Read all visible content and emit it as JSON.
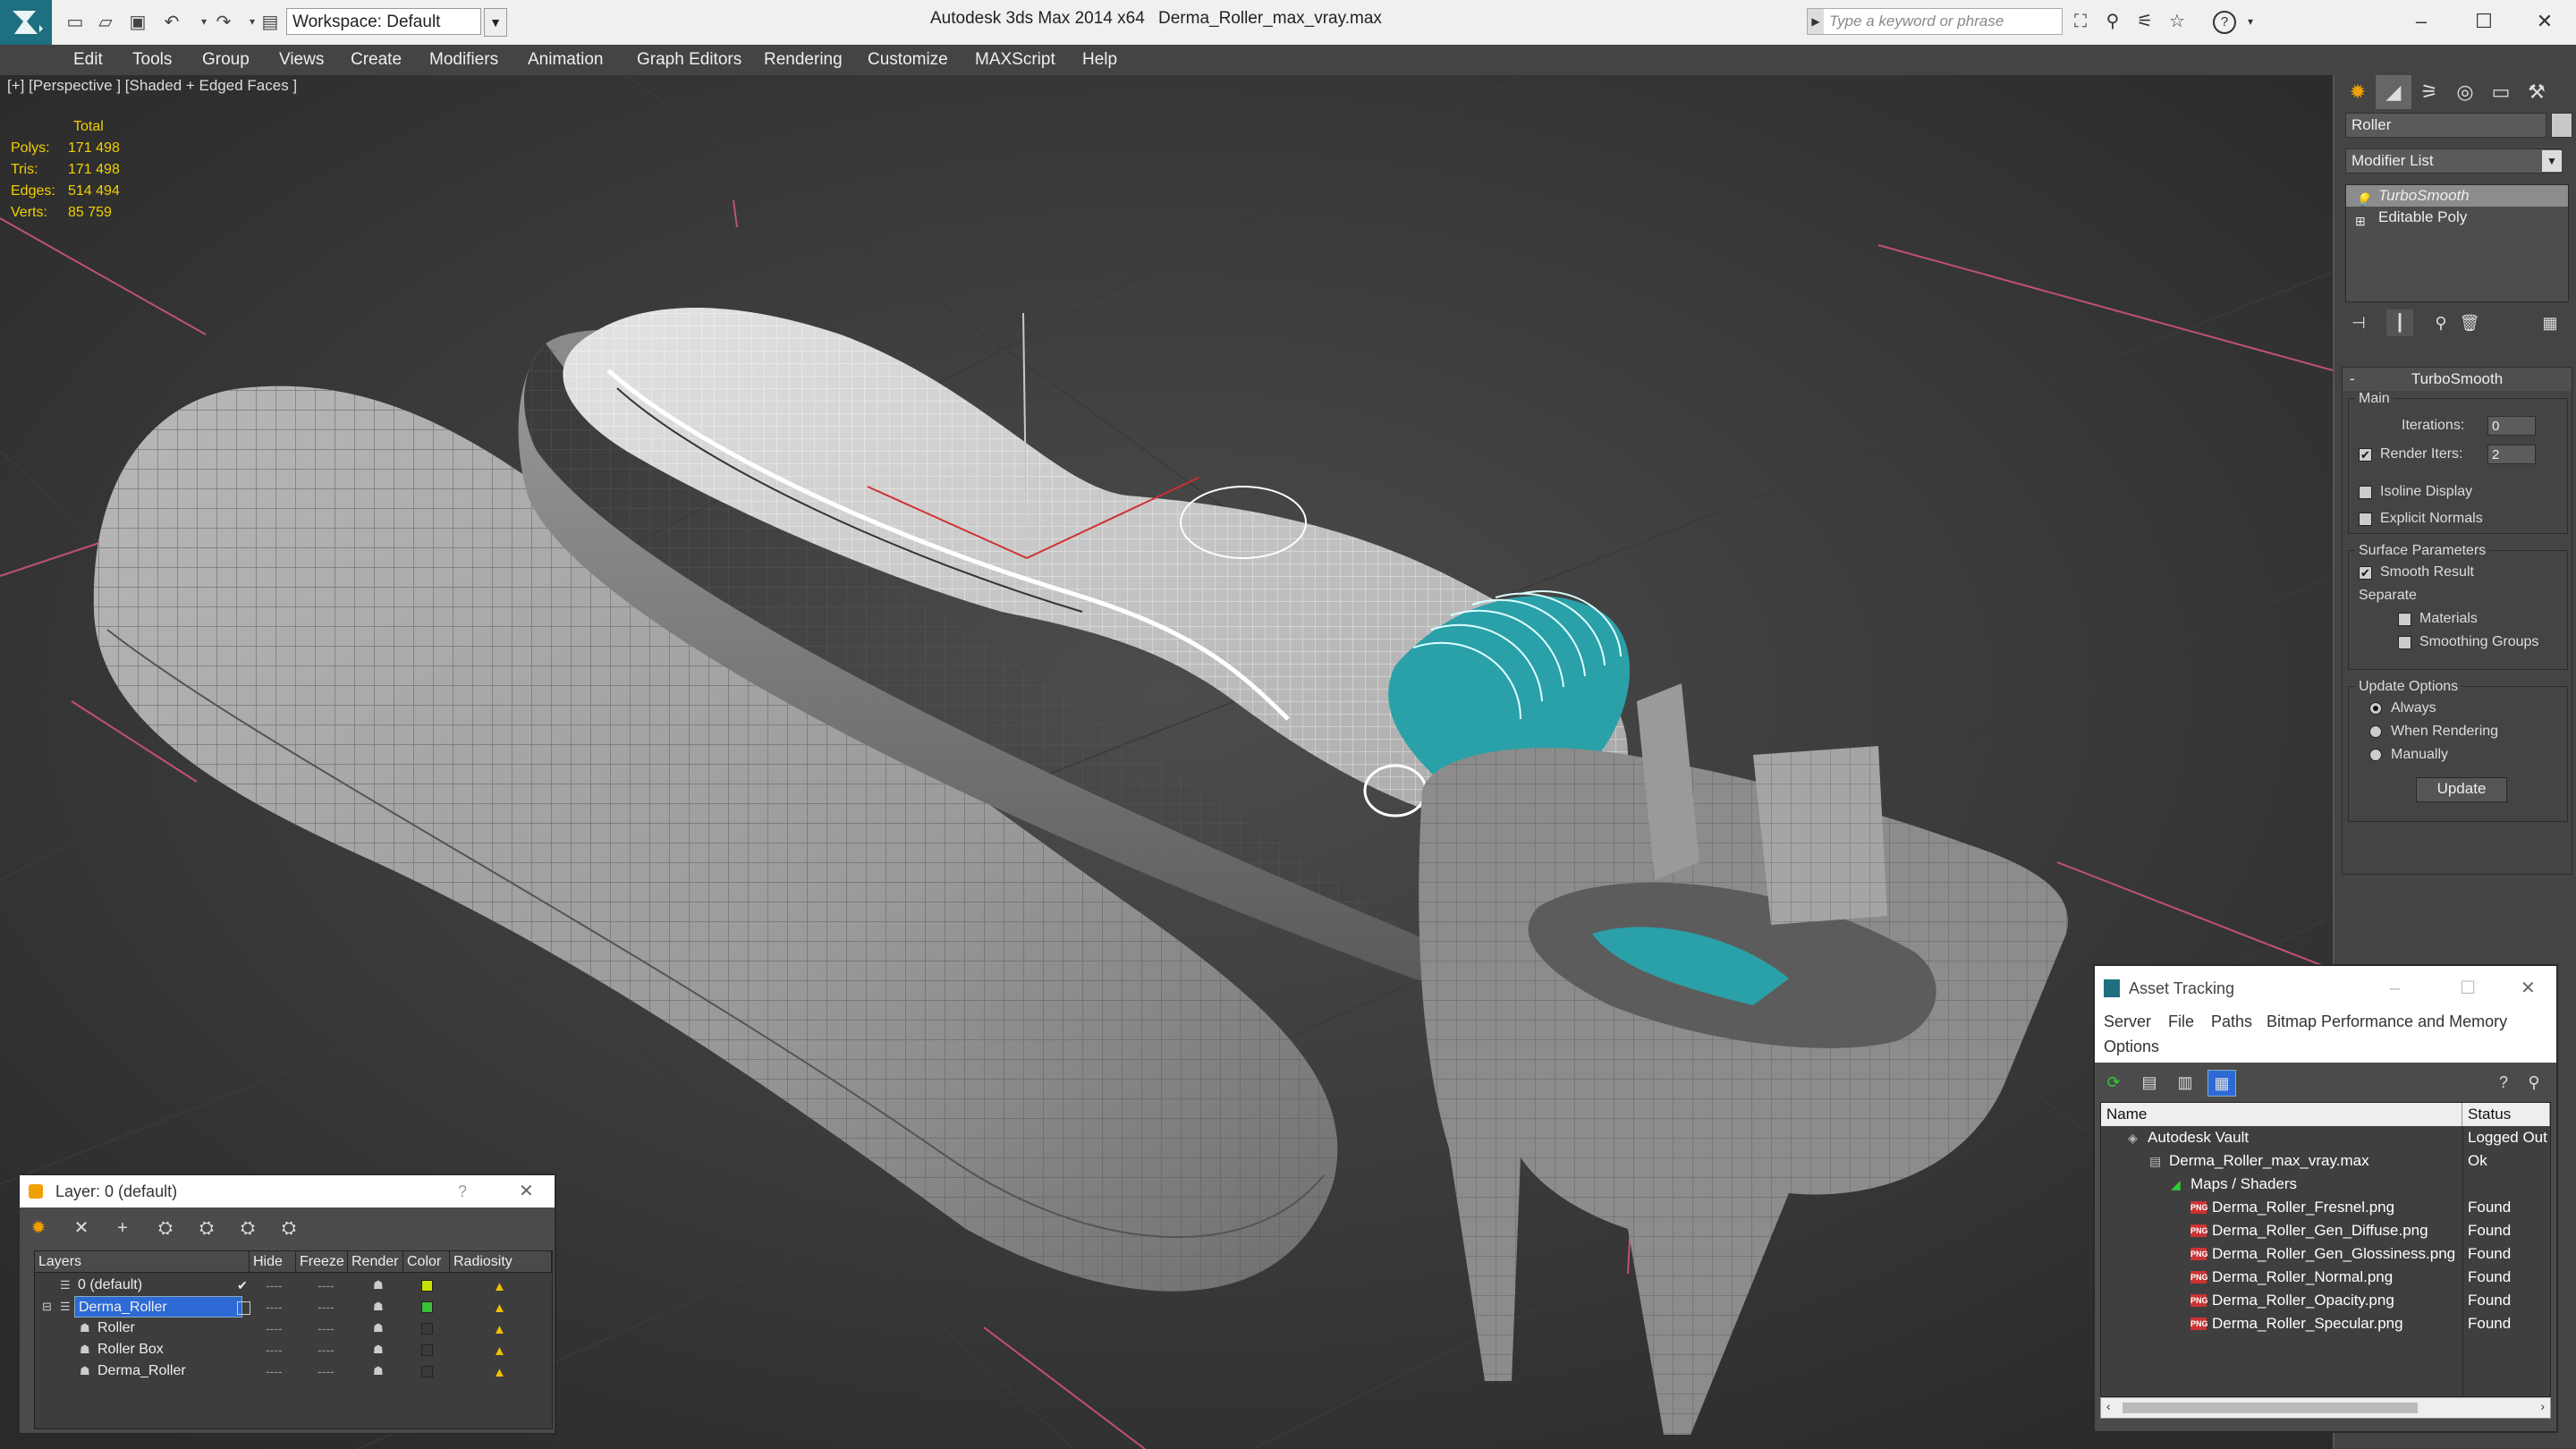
{
  "titlebar": {
    "workspace": "Workspace: Default",
    "app_title": "Autodesk 3ds Max  2014 x64",
    "file_title": "Derma_Roller_max_vray.max",
    "search_placeholder": "Type a keyword or phrase"
  },
  "menu": [
    "Edit",
    "Tools",
    "Group",
    "Views",
    "Create",
    "Modifiers",
    "Animation",
    "Graph Editors",
    "Rendering",
    "Customize",
    "MAXScript",
    "Help"
  ],
  "viewport": {
    "label": "[+] [Perspective ] [Shaded + Edged Faces ]",
    "stats_header": "Total",
    "stats": [
      {
        "label": "Polys:",
        "value": "171 498"
      },
      {
        "label": "Tris:",
        "value": "171 498"
      },
      {
        "label": "Edges:",
        "value": "514 494"
      },
      {
        "label": "Verts:",
        "value": "85 759"
      }
    ]
  },
  "command_panel": {
    "object_name": "Roller",
    "modifier_list": "Modifier List",
    "stack": [
      "TurboSmooth",
      "Editable Poly"
    ],
    "rollout_title": "TurboSmooth",
    "main_group": "Main",
    "iterations_label": "Iterations:",
    "iterations_value": "0",
    "render_iters_label": "Render Iters:",
    "render_iters_value": "2",
    "isoline_label": "Isoline Display",
    "explicit_label": "Explicit Normals",
    "surface_group": "Surface Parameters",
    "smooth_label": "Smooth Result",
    "separate_label": "Separate",
    "materials_label": "Materials",
    "smoothing_groups_label": "Smoothing Groups",
    "update_group": "Update Options",
    "always_label": "Always",
    "when_rendering_label": "When Rendering",
    "manually_label": "Manually",
    "update_button": "Update"
  },
  "layer_dialog": {
    "title": "Layer: 0 (default)",
    "help": "?",
    "columns": [
      "Layers",
      "Hide",
      "Freeze",
      "Render",
      "Color",
      "Radiosity"
    ],
    "rows": [
      {
        "name": "0 (default)",
        "color": "#c8e000",
        "indent": 1
      },
      {
        "name": "Derma_Roller",
        "color": "#38c038",
        "indent": 1
      },
      {
        "name": "Roller",
        "color": "#3a3a3a",
        "indent": 2
      },
      {
        "name": "Roller Box",
        "color": "#3a3a3a",
        "indent": 2
      },
      {
        "name": "Derma_Roller",
        "color": "#3a3a3a",
        "indent": 2
      }
    ]
  },
  "asset_dialog": {
    "title": "Asset Tracking",
    "menu": [
      "Server",
      "File",
      "Paths",
      "Bitmap Performance and Memory",
      "Options"
    ],
    "columns": [
      "Name",
      "Status"
    ],
    "rows": [
      {
        "name": "Autodesk Vault",
        "status": "Logged Out",
        "indent": 1,
        "icon": "vault"
      },
      {
        "name": "Derma_Roller_max_vray.max",
        "status": "Ok",
        "indent": 2,
        "icon": "max"
      },
      {
        "name": "Maps / Shaders",
        "status": "",
        "indent": 3,
        "icon": "folder"
      },
      {
        "name": "Derma_Roller_Fresnel.png",
        "status": "Found",
        "indent": 4,
        "icon": "png"
      },
      {
        "name": "Derma_Roller_Gen_Diffuse.png",
        "status": "Found",
        "indent": 4,
        "icon": "png"
      },
      {
        "name": "Derma_Roller_Gen_Glossiness.png",
        "status": "Found",
        "indent": 4,
        "icon": "png"
      },
      {
        "name": "Derma_Roller_Normal.png",
        "status": "Found",
        "indent": 4,
        "icon": "png"
      },
      {
        "name": "Derma_Roller_Opacity.png",
        "status": "Found",
        "indent": 4,
        "icon": "png"
      },
      {
        "name": "Derma_Roller_Specular.png",
        "status": "Found",
        "indent": 4,
        "icon": "png"
      }
    ]
  },
  "colors": {
    "viewport_bg": "#434343",
    "stats_text": "#f0d000",
    "roller_teal": "#2aa0a8",
    "selection_blue": "#2d6ad6"
  }
}
